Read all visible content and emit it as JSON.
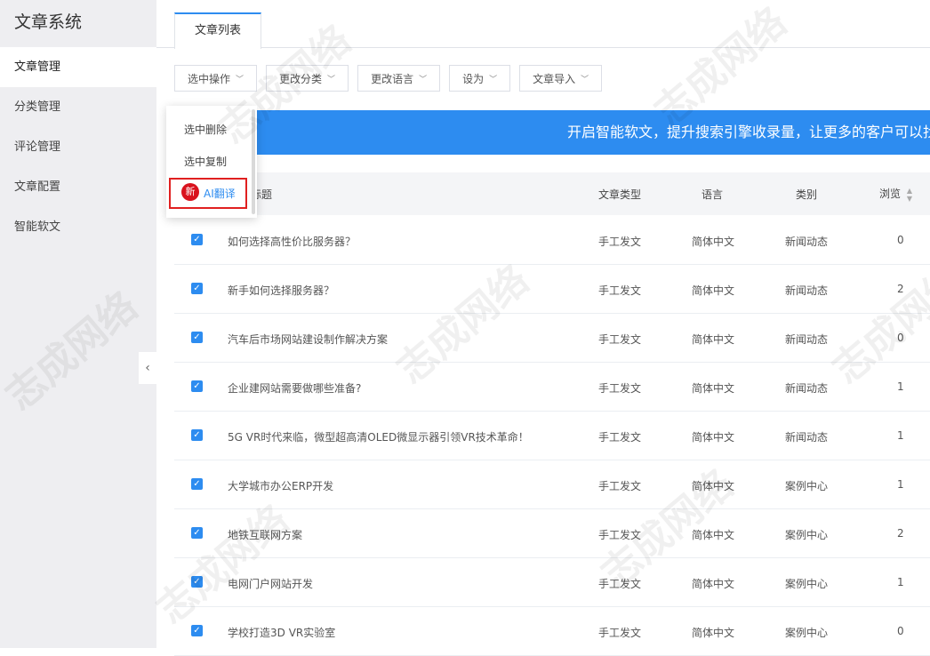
{
  "sidebar": {
    "title": "文章系统",
    "items": [
      {
        "label": "文章管理",
        "active": true
      },
      {
        "label": "分类管理",
        "active": false
      },
      {
        "label": "评论管理",
        "active": false
      },
      {
        "label": "文章配置",
        "active": false
      },
      {
        "label": "智能软文",
        "active": false
      }
    ],
    "collapse_icon": "‹"
  },
  "tabs": [
    "文章列表"
  ],
  "toolbar": {
    "select_ops": "选中操作",
    "change_category": "更改分类",
    "change_language": "更改语言",
    "set_as": "设为",
    "import": "文章导入"
  },
  "dropdown": {
    "items": [
      "选中删除",
      "选中复制"
    ],
    "new_badge": "新",
    "ai_translate": "AI翻译"
  },
  "banner": "开启智能软文，提升搜索引擎收录量，让更多的客户可以找到您",
  "table": {
    "headers": {
      "title": "标题",
      "type": "文章类型",
      "lang": "语言",
      "category": "类别",
      "views": "浏览"
    },
    "rows": [
      {
        "title": "如何选择高性价比服务器？",
        "type": "手工发文",
        "lang": "简体中文",
        "category": "新闻动态",
        "views": "0"
      },
      {
        "title": "新手如何选择服务器？",
        "type": "手工发文",
        "lang": "简体中文",
        "category": "新闻动态",
        "views": "2"
      },
      {
        "title": "汽车后市场网站建设制作解决方案",
        "type": "手工发文",
        "lang": "简体中文",
        "category": "新闻动态",
        "views": "0"
      },
      {
        "title": "企业建网站需要做哪些准备?",
        "type": "手工发文",
        "lang": "简体中文",
        "category": "新闻动态",
        "views": "1"
      },
      {
        "title": "5G VR时代来临，微型超高清OLED微显示器引领VR技术革命！",
        "type": "手工发文",
        "lang": "简体中文",
        "category": "新闻动态",
        "views": "1"
      },
      {
        "title": "大学城市办公ERP开发",
        "type": "手工发文",
        "lang": "简体中文",
        "category": "案例中心",
        "views": "1"
      },
      {
        "title": "地铁互联网方案",
        "type": "手工发文",
        "lang": "简体中文",
        "category": "案例中心",
        "views": "2"
      },
      {
        "title": "电网门户网站开发",
        "type": "手工发文",
        "lang": "简体中文",
        "category": "案例中心",
        "views": "1"
      },
      {
        "title": "学校打造3D VR实验室",
        "type": "手工发文",
        "lang": "简体中文",
        "category": "案例中心",
        "views": "0"
      }
    ]
  },
  "watermark": "志成网络"
}
